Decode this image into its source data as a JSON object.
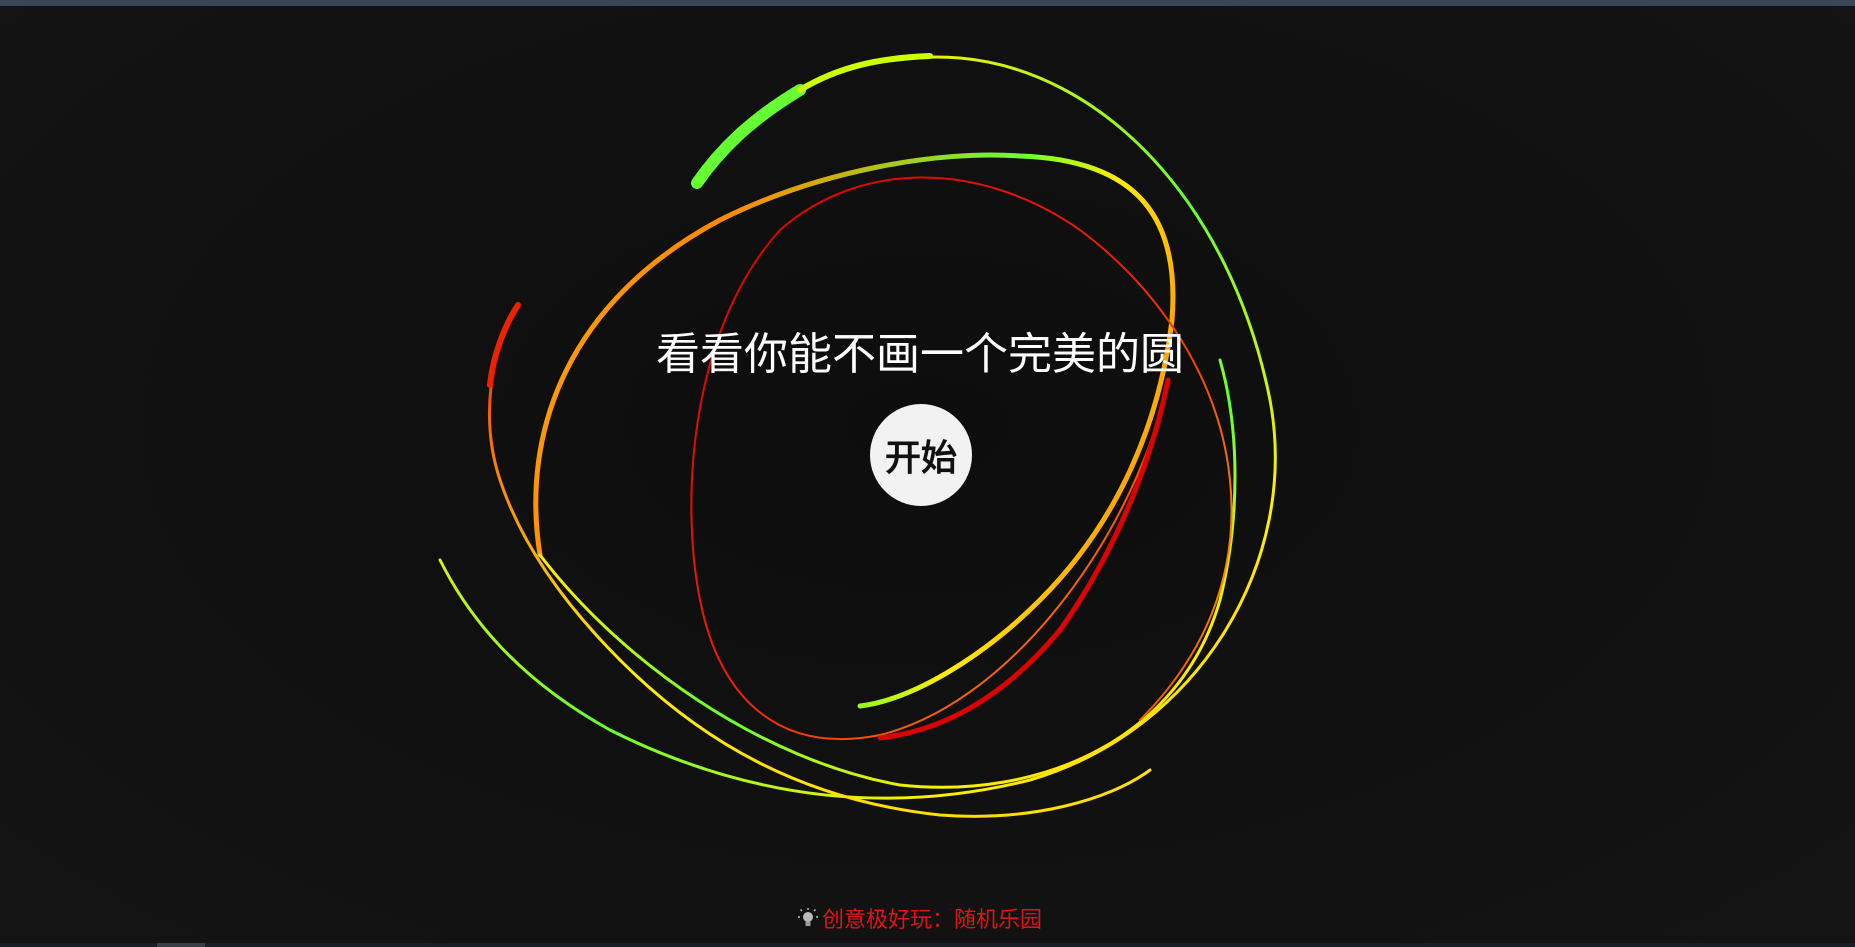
{
  "title": "看看你能不画一个完美的圆",
  "start_button": "开始",
  "footer": {
    "text": "创意极好玩：随机乐园",
    "icon": "lightbulb-icon",
    "color": "#e01414"
  },
  "colors": {
    "background": "#0c0c0c",
    "text": "#ffffff",
    "button_bg": "#f2f2f2",
    "stroke_good": "#66ff33",
    "stroke_mid": "#ffee00",
    "stroke_bad": "#dd0000"
  }
}
